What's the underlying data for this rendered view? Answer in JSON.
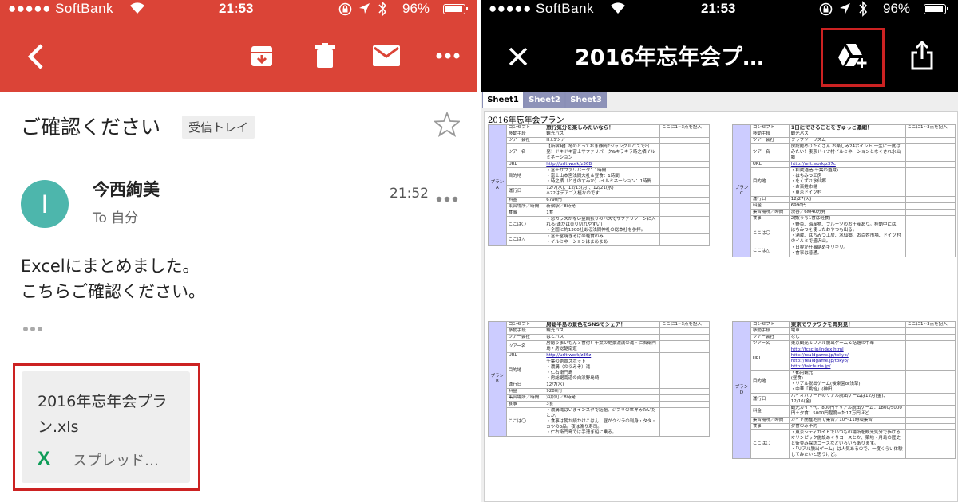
{
  "left": {
    "status": {
      "carrier": "●●●●● SoftBank",
      "time": "21:53",
      "battery": "96%"
    },
    "email": {
      "subject": "ご確認ください",
      "label": "受信トレイ",
      "avatar_initial": "I",
      "sender": "今西絢美",
      "to": "To 自分",
      "time": "21:52",
      "body": [
        "Excelにまとめました。",
        "こちらご確認ください。"
      ],
      "attachment": {
        "name_line1": "2016年忘年会プラ",
        "name_line2": "ン.xls",
        "icon": "X",
        "type": "スプレッド…"
      }
    }
  },
  "right": {
    "status": {
      "carrier": "●●●●● SoftBank",
      "time": "21:53",
      "battery": "96%"
    },
    "title": "2016年忘年会プ…",
    "tabs": [
      "Sheet1",
      "Sheet2",
      "Sheet3"
    ],
    "sheet_title": "2016年忘年会プラン",
    "plans": [
      {
        "group": "プランA",
        "note": "ここに1~3点を記入",
        "rows": [
          [
            "コンセプト",
            "旅行気分を楽しみたいなら！"
          ],
          [
            "移動手段",
            "観光バス"
          ],
          [
            "ツアー会社",
            "H.I.Sツアー"
          ],
          [
            "ツアー名",
            "【新宿発】冬のとっておき静岡♪ジャングルパスで出発！ドキドキ富士サファリパーク&キラキラ時之栖イルミネーション"
          ],
          [
            "URL",
            "http://urlt.work/z36B"
          ],
          [
            "目的地",
            "・富士サファリパーク：1時間\n・富士山本宮浅間大社＆昼食：1時間\n・時之栖（ときのすみか）-イルミネーション：1時間"
          ],
          [
            "運行日",
            "12/7(水)、12/13(月)、12/21(水)\n※22はデアゴ入植なのです"
          ],
          [
            "料金",
            "6790円"
          ],
          [
            "集合場所／時間",
            "新宿駅／8時発"
          ],
          [
            "食事",
            "1食"
          ],
          [
            "ここは〇",
            "・窓ガラスがない金網張りのバスでサファリゾーンに入れる(運がは売り切れやすい)\n・全国に約1300社ある浅間神社の総本社を参拝。"
          ],
          [
            "ここは△",
            "・富士宮焼きそばの軽食のみ\n・イルミネーションはまあまあ"
          ]
        ]
      },
      {
        "group": "プランB",
        "note": "ここに1~3点を記入",
        "rows": [
          [
            "コンセプト",
            "房総半島の景色をSNSでシェア！"
          ],
          [
            "移動手段",
            "観光バス"
          ],
          [
            "ツアー会社",
            "はとバス"
          ],
          [
            "ツアー名",
            "房総うまいもん３食付！千葉の絶景濃満の滝・仁右衛門島・房総鋸南道"
          ],
          [
            "URL",
            "http://urlt.work/z36z"
          ],
          [
            "目的地",
            "千葉の絶景スポット\n・濃溝（のうみぞ）滝\n・仁右衛門島\n・房総鋸南道の白浜野島崎"
          ],
          [
            "運行日",
            "12/7(水)"
          ],
          [
            "料金",
            "9280円"
          ],
          [
            "集合場所／時間",
            "浜松町／8時発"
          ],
          [
            "食事",
            "3食"
          ],
          [
            "ここは〇",
            "・濃溝滝はいまインスタで話題。ジブリの世界みたいだとか。\n・食事は朝が続かけこはん、昼がクジラの刺身・タタ・カツの3品。夜は漁り寿司。\n・仁右衛門島では手漕ぎ船に乗る。"
          ]
        ]
      },
      {
        "group": "プランC",
        "note": "ここに1~3点を記入",
        "rows": [
          [
            "コンセプト",
            "1日にできることをぎゅっと濃縮！"
          ],
          [
            "移動手段",
            "観光バス"
          ],
          [
            "ツアー会社",
            "クラブツーリズム"
          ],
          [
            "ツアー名",
            "房総館めりたくさん お楽しみ24ポイント 一生に一度はみたい！東京ドイツ村イルミネーションとなぐされ水仙郷"
          ],
          [
            "URL",
            "http://urlt.work/z37c"
          ],
          [
            "目的地",
            "・和蔵酒造(千葉の酒蔵)\n・はちみつ工房\n・をくずれ水仙郷\n・お百姓市場\n・東京ドイツ村"
          ],
          [
            "運行日",
            "12/27(火)"
          ],
          [
            "料金",
            "6990円"
          ],
          [
            "集合場所／時間",
            "渋谷／6時40分発"
          ],
          [
            "食事",
            "2食(うち1食は軽食)"
          ],
          [
            "ここは〇",
            "・野菜、海産物、フルーツのお土産あり。移動中には、はちみつを使ったおやつも出る。\n・酒蔵、はちみつ工房、水仙郷、お百姓市場、ドイツ村のイルミで盛沢山。"
          ],
          [
            "ここは△",
            "・日程が仕事納めギリギリ。\n・食事は普通。"
          ]
        ]
      },
      {
        "group": "プランD",
        "note": "ここに1~3点を記入",
        "rows": [
          [
            "コンセプト",
            "東京でワクワクを再発見！"
          ],
          [
            "移動手段",
            "電車"
          ],
          [
            "ツアー会社",
            "なし"
          ],
          [
            "ツアー名",
            "東京観光＆リアル脱出ゲーム＆話題の中華"
          ],
          [
            "URL",
            "http://tcsc.jp/index.html\nhttp://realdgame.jp/tokyo/\nhttp://realdgame.jp/tokyo/\nhttp://taichuria.jp/"
          ],
          [
            "目的地",
            "・都内観光\n(昼食)\n・リアル脱出ゲーム(後楽園or浅草)\n・中華「桃怡」(神田)"
          ],
          [
            "運行日",
            "バイオハザードのリアル脱出ゲームは12月(金)、12/16(金)"
          ],
          [
            "料金",
            "観光ガイド代：800円＋リアル脱出ゲーム：1800/5000円＋夕食：5000円程度＝計17万円ほど"
          ],
          [
            "集合場所／時間",
            "ガイド開催地点で集合／10〜11時頃集合"
          ],
          [
            "食事",
            "夕食のみ予約"
          ],
          [
            "ここは〇",
            "・東京シティガイドでいつもの場所を観光気分で歩けるオリンピック施設めぐりコースとか、築地・月島の歴史と街並み探訪コースなどいろいろあります。\n・「リアル脱出ゲーム」は人気あるので、一度くらい体験してみたいと思うけど。"
          ]
        ]
      }
    ]
  }
}
